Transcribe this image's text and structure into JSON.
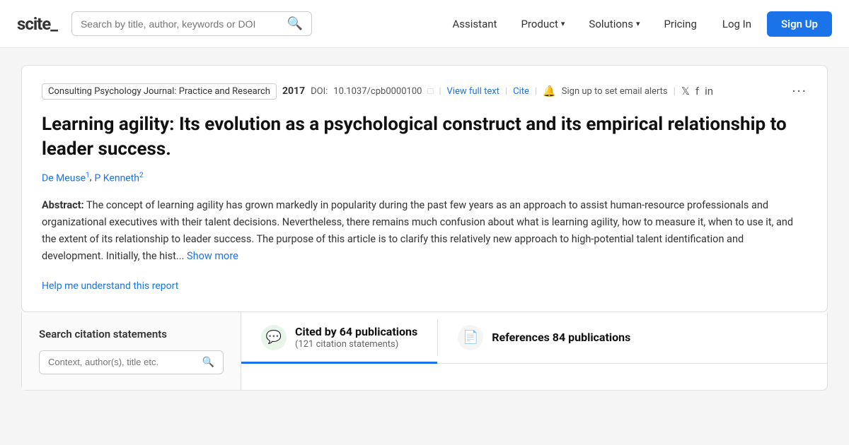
{
  "nav": {
    "logo": "scite_",
    "search_placeholder": "Search by title, author, keywords or DOI",
    "links": [
      {
        "label": "Assistant",
        "has_chevron": false
      },
      {
        "label": "Product",
        "has_chevron": true
      },
      {
        "label": "Solutions",
        "has_chevron": true
      },
      {
        "label": "Pricing",
        "has_chevron": false
      }
    ],
    "login_label": "Log In",
    "signup_label": "Sign Up"
  },
  "paper": {
    "journal": "Consulting Psychology Journal: Practice and Research",
    "year": "2017",
    "doi_label": "DOI:",
    "doi": "10.1037/cpb0000100",
    "view_full_text": "View full text",
    "cite": "Cite",
    "alert_text": "Sign up to set email alerts",
    "title": "Learning agility: Its evolution as a psychological construct and its empirical relationship to leader success.",
    "authors": [
      {
        "name": "De Meuse",
        "sup": "1"
      },
      {
        "name": "P Kenneth",
        "sup": "2"
      }
    ],
    "abstract_label": "Abstract:",
    "abstract_text": "The concept of learning agility has grown markedly in popularity during the past few years as an approach to assist human-resource professionals and organizational executives with their talent decisions. Nevertheless, there remains much confusion about what is learning agility, how to measure it, when to use it, and the extent of its relationship to leader success. The purpose of this article is to clarify this relatively new approach to high-potential talent identification and development. Initially, the hist...",
    "show_more": "Show more",
    "help_link": "Help me understand this report"
  },
  "citation_search": {
    "title": "Search citation statements",
    "placeholder": "Context, author(s), title etc."
  },
  "tabs": [
    {
      "icon_type": "green",
      "icon_char": "💬",
      "label_main": "Cited by 64 publications",
      "label_sub": "(121 citation statements)",
      "active": true
    },
    {
      "icon_type": "gray",
      "icon_char": "📄",
      "label_main": "References 84 publications",
      "label_sub": "",
      "active": false
    }
  ]
}
